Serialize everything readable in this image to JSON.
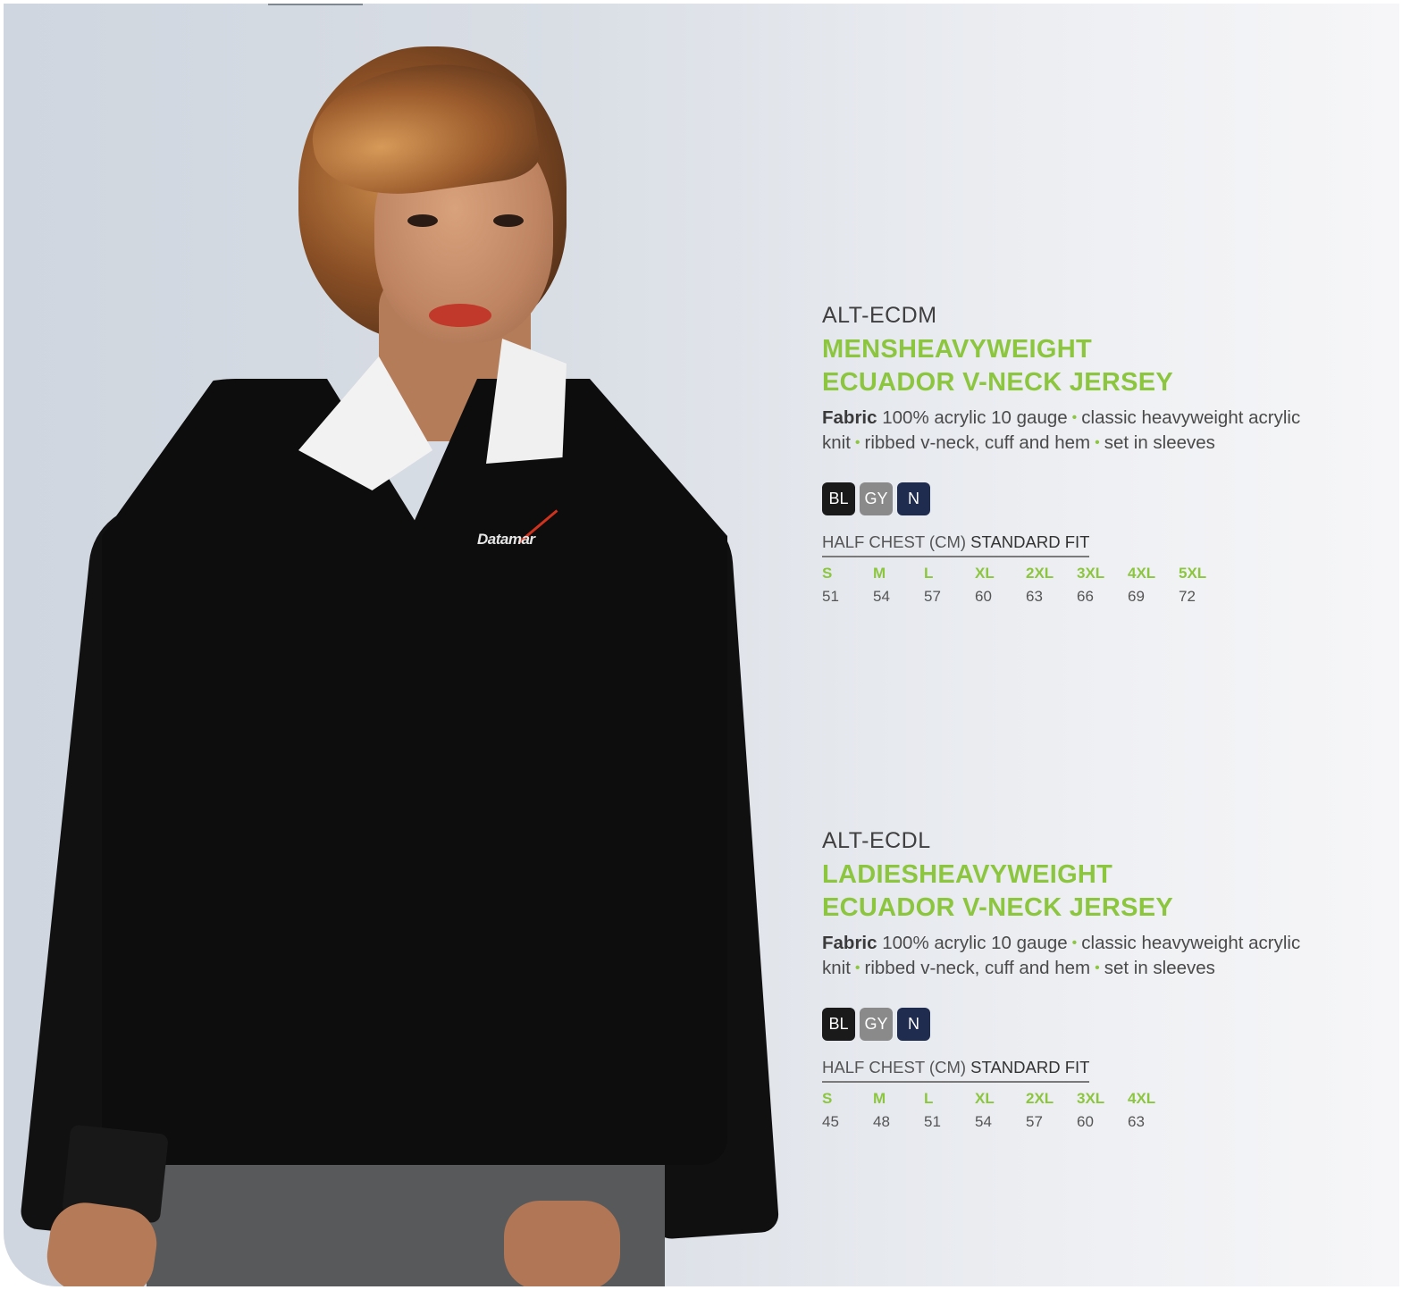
{
  "colors": {
    "accent_green": "#8cc63f",
    "swatch_black": "#1a1a1a",
    "swatch_grey": "#8a8a8a",
    "swatch_navy": "#1f2c4f"
  },
  "photo": {
    "logo_text": "Datamar"
  },
  "products": [
    {
      "code": "ALT-ECDM",
      "name_line1": "MENSHEAVYWEIGHT",
      "name_line2": "ECUADOR V-NECK JERSEY",
      "fabric_label": "Fabric",
      "fabric_part1": "100% acrylic 10 gauge",
      "fabric_part2": "classic heavyweight acrylic knit",
      "fabric_part3": "ribbed v-neck, cuff and hem",
      "fabric_part4": "set in sleeves",
      "swatches": [
        "BL",
        "GY",
        "N"
      ],
      "size_heading": "HALF CHEST (CM)",
      "fit": "STANDARD FIT",
      "sizes": [
        "S",
        "M",
        "L",
        "XL",
        "2XL",
        "3XL",
        "4XL",
        "5XL"
      ],
      "values": [
        "51",
        "54",
        "57",
        "60",
        "63",
        "66",
        "69",
        "72"
      ]
    },
    {
      "code": "ALT-ECDL",
      "name_line1": "LADIESHEAVYWEIGHT",
      "name_line2": "ECUADOR V-NECK JERSEY",
      "fabric_label": "Fabric",
      "fabric_part1": "100% acrylic 10 gauge",
      "fabric_part2": "classic heavyweight acrylic knit",
      "fabric_part3": "ribbed v-neck, cuff and hem",
      "fabric_part4": "set in sleeves",
      "swatches": [
        "BL",
        "GY",
        "N"
      ],
      "size_heading": "HALF CHEST (CM)",
      "fit": "STANDARD FIT",
      "sizes": [
        "S",
        "M",
        "L",
        "XL",
        "2XL",
        "3XL",
        "4XL"
      ],
      "values": [
        "45",
        "48",
        "51",
        "54",
        "57",
        "60",
        "63"
      ]
    }
  ]
}
